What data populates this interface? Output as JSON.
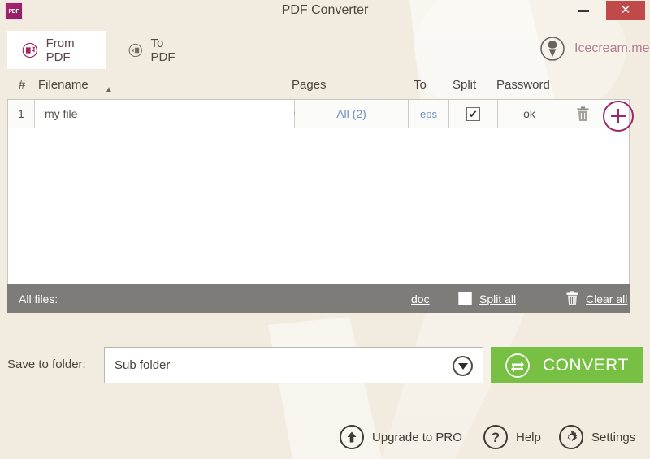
{
  "window": {
    "title": "PDF Converter",
    "app_icon": "pdf-app-icon",
    "app_icon_glyph": "PDF",
    "minimize_label": "—",
    "close_label": "✕",
    "close_color": "#c04a4a"
  },
  "brand": {
    "label": "Icecream.me",
    "icon": "icecream-cone-icon",
    "color": "#b07e95"
  },
  "tabs": [
    {
      "label": "From PDF",
      "icon": "from-pdf-icon",
      "active": true
    },
    {
      "label": "To PDF",
      "icon": "to-pdf-icon",
      "active": false
    }
  ],
  "table": {
    "headers": {
      "num": "#",
      "filename": "Filename",
      "sort_indicator": "▲",
      "pages": "Pages",
      "to": "To",
      "split": "Split",
      "password": "Password"
    },
    "rows": [
      {
        "num": "1",
        "filename": "my file",
        "search_icon": "magnifier-icon",
        "pages": "All (2)",
        "to": "eps",
        "split_checked": true,
        "split_mark": "✔",
        "password": "ok",
        "delete_icon": "trash-icon"
      }
    ],
    "add_button": {
      "icon": "plus-circle-icon",
      "color": "#9e2765"
    }
  },
  "allfiles_bar": {
    "label": "All files:",
    "format_link": "doc",
    "split_all_label": "Split all",
    "split_all_checked": false,
    "clear_all_label": "Clear all",
    "clear_all_icon": "trash-icon",
    "background": "#7e7c79"
  },
  "save_row": {
    "label": "Save to folder:",
    "folder_value": "Sub folder",
    "folder_placeholder": "Sub folder",
    "dropdown_icon": "chevron-down-circle-icon",
    "convert_label": "CONVERT",
    "convert_icon": "convert-arrows-icon",
    "convert_color": "#77c043"
  },
  "bottom_bar": {
    "items": [
      {
        "label": "Upgrade to PRO",
        "icon": "up-arrow-circle-icon"
      },
      {
        "label": "Help",
        "icon": "question-mark-circle-icon"
      },
      {
        "label": "Settings",
        "icon": "gear-circle-icon"
      }
    ]
  },
  "theme": {
    "background": "#f2ece0",
    "panel": "#ffffff",
    "accent": "#9e2765",
    "link": "#6a8ec2"
  }
}
